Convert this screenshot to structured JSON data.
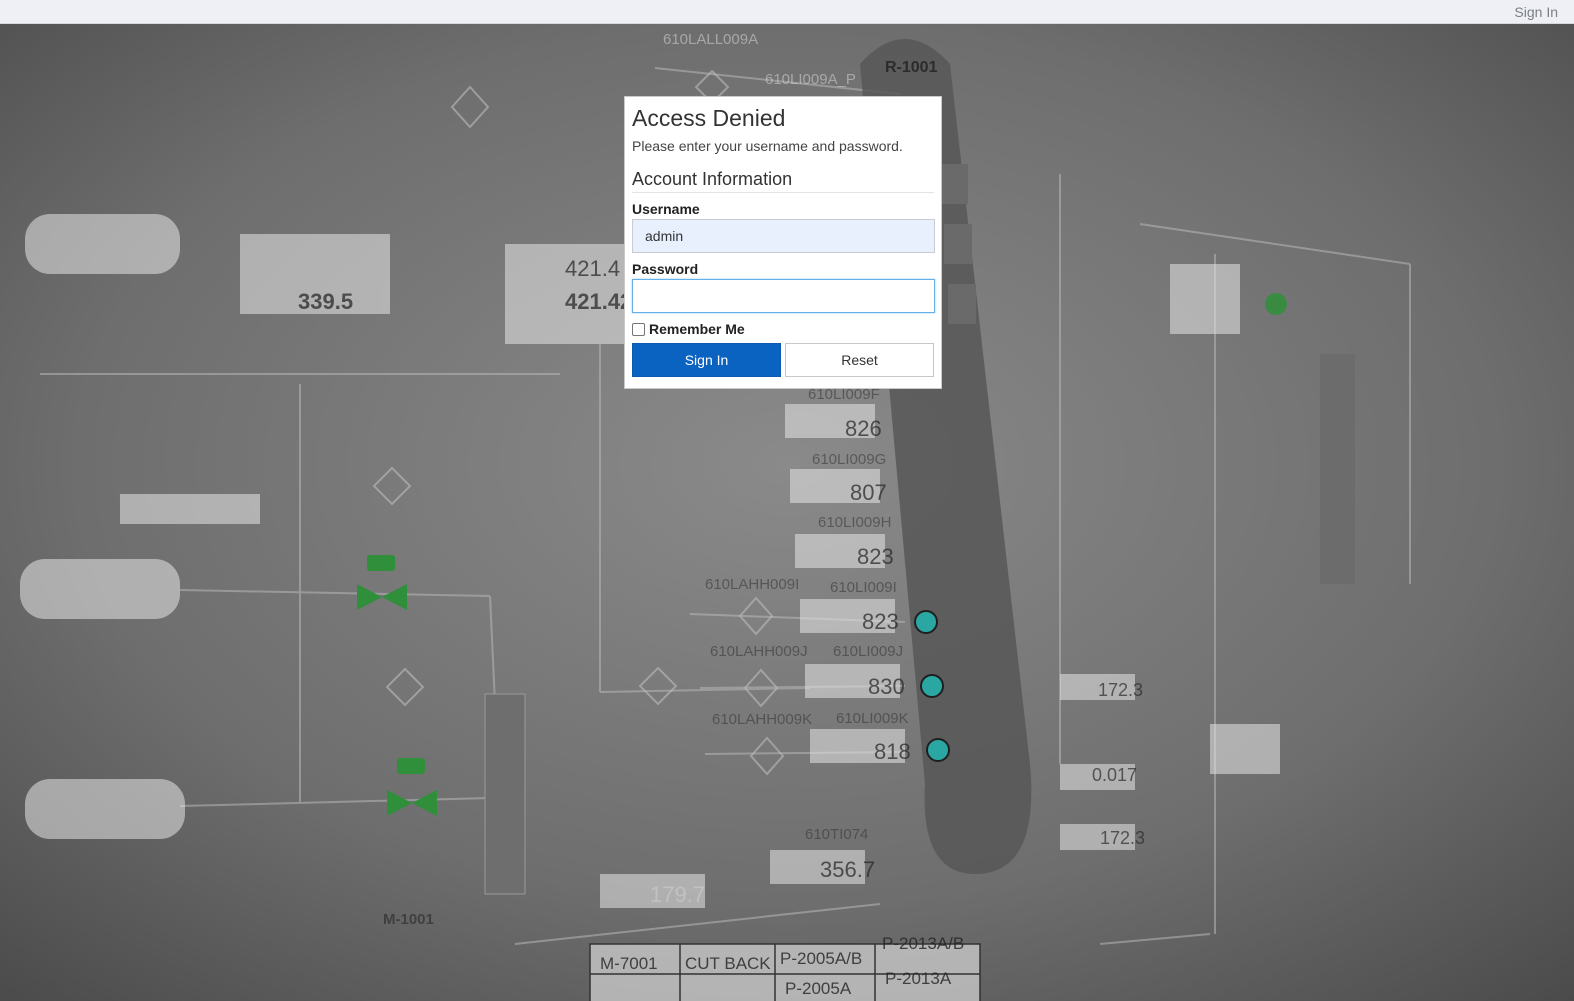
{
  "topbar": {
    "signin_link": "Sign In"
  },
  "dialog": {
    "title": "Access Denied",
    "subtitle": "Please enter your username and password.",
    "section_title": "Account Information",
    "username_label": "Username",
    "username_value": "admin",
    "password_label": "Password",
    "password_value": "",
    "remember_label": "Remember Me",
    "remember_checked": false,
    "signin_button": "Sign In",
    "reset_button": "Reset"
  },
  "background": {
    "vessel_tag": "R-1001",
    "labels": [
      "610LALL009A",
      "610LI009A_P",
      "610LI009F",
      "610LI009G",
      "610LI009H",
      "610LAHH009I",
      "610LI009I",
      "610LAHH009J",
      "610LI009J",
      "610LAHH009K",
      "610LI009K",
      "610TI074",
      "M-1001"
    ],
    "readouts": [
      "421.4",
      "421.42",
      "826",
      "807",
      "823",
      "823",
      "830",
      "818",
      "356.7",
      "179.7",
      "172.3",
      "0.017",
      "172.3",
      "339.5"
    ],
    "table_headers": [
      "M-7001",
      "CUT BACK",
      "P-2005A/B",
      "P-2013A/B"
    ],
    "table_row": [
      "P-2005A",
      "P-2013A"
    ],
    "colors": {
      "valve": "#2f8f3a",
      "indicator": "#2aa7a3"
    }
  }
}
